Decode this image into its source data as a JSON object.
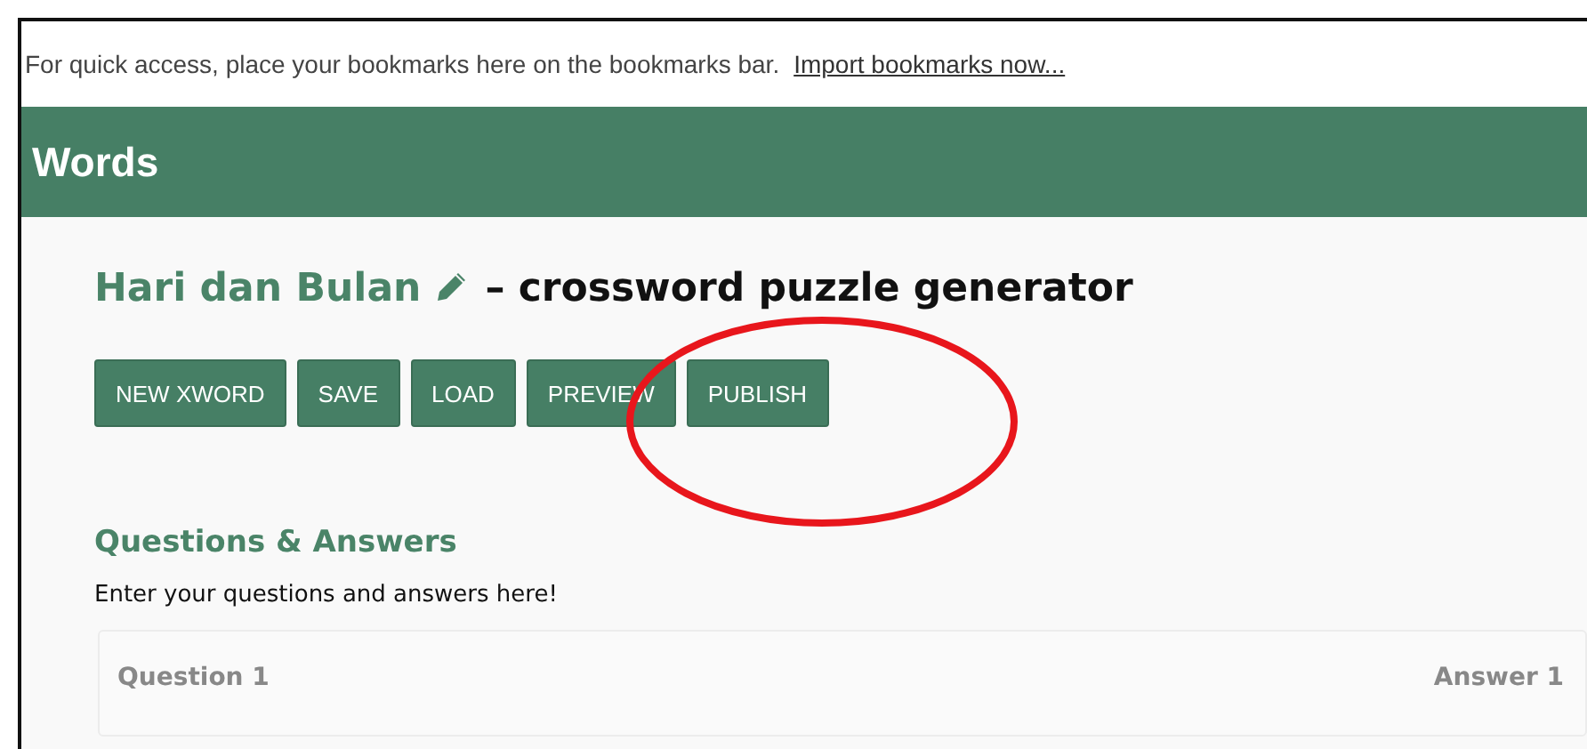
{
  "bookmarks_bar": {
    "message": "For quick access, place your bookmarks here on the bookmarks bar.",
    "link": "Import bookmarks now..."
  },
  "header": {
    "title": "Words"
  },
  "page_title": {
    "name": "Hari dan Bulan",
    "subtitle": "– crossword puzzle generator"
  },
  "buttons": [
    "NEW XWORD",
    "SAVE",
    "LOAD",
    "PREVIEW",
    "PUBLISH"
  ],
  "section": {
    "heading": "Questions & Answers",
    "description": "Enter your questions and answers here!"
  },
  "qa_card": {
    "question_label": "Question 1",
    "answer_label": "Answer 1"
  }
}
